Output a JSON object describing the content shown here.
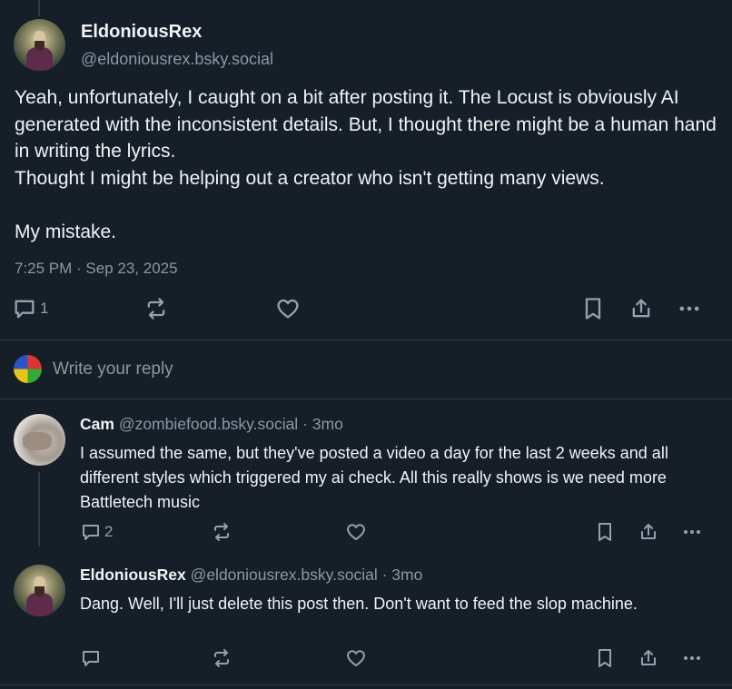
{
  "main_post": {
    "author": {
      "display_name": "EldoniousRex",
      "handle": "@eldoniousrex.bsky.social"
    },
    "text": "Yeah, unfortunately, I caught on a bit after posting it. The Locust is obviously AI generated with the inconsistent details. But, I thought there might be a human hand in writing the lyrics.\nThought I might be helping out a creator who isn't getting many views.\n\nMy mistake.",
    "timestamp": "7:25 PM · Sep 23, 2025",
    "reply_count": "1"
  },
  "composer": {
    "placeholder": "Write your reply"
  },
  "replies": [
    {
      "display_name": "Cam",
      "handle": "@zombiefood.bsky.social",
      "age": "3mo",
      "text": "I assumed the same, but they've posted a video a day for the last 2 weeks and all different styles which triggered my ai check. All this really shows is we need more Battletech music",
      "reply_count": "2"
    },
    {
      "display_name": "EldoniousRex",
      "handle": "@eldoniousrex.bsky.social",
      "age": "3mo",
      "text": "Dang. Well, I'll just delete this post then. Don't want to feed the slop machine.",
      "reply_count": ""
    }
  ],
  "colors": {
    "background": "#161e27",
    "text": "#f1f3f5",
    "muted": "#8b98a5",
    "divider": "#2e3a48"
  },
  "icons": {
    "reply": "speech-bubble-icon",
    "repost": "repost-arrows-icon",
    "like": "heart-icon",
    "bookmark": "bookmark-icon",
    "share": "share-upload-icon",
    "more": "ellipsis-icon"
  }
}
